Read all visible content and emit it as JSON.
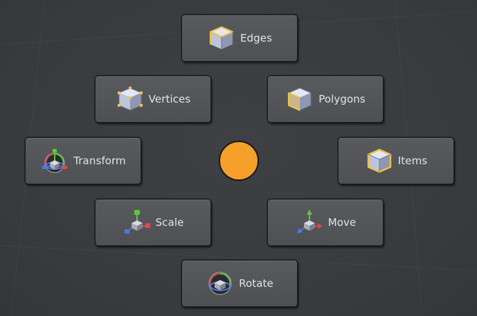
{
  "pie_menu": {
    "items": [
      {
        "key": "edges",
        "label": "Edges",
        "icon": "edges-cube-icon"
      },
      {
        "key": "vertices",
        "label": "Vertices",
        "icon": "vertices-cube-icon"
      },
      {
        "key": "polygons",
        "label": "Polygons",
        "icon": "polygons-cube-icon"
      },
      {
        "key": "transform",
        "label": "Transform",
        "icon": "transform-gizmo-icon"
      },
      {
        "key": "items",
        "label": "Items",
        "icon": "items-cube-icon"
      },
      {
        "key": "scale",
        "label": "Scale",
        "icon": "scale-gizmo-icon"
      },
      {
        "key": "move",
        "label": "Move",
        "icon": "move-gizmo-icon"
      },
      {
        "key": "rotate",
        "label": "Rotate",
        "icon": "rotate-gizmo-icon"
      }
    ]
  },
  "colors": {
    "highlight": "#f0c24a",
    "center_dot": "#f5a02a",
    "axis_x": "#e0484b",
    "axis_y": "#5ac83a",
    "axis_z": "#4c78e6"
  }
}
